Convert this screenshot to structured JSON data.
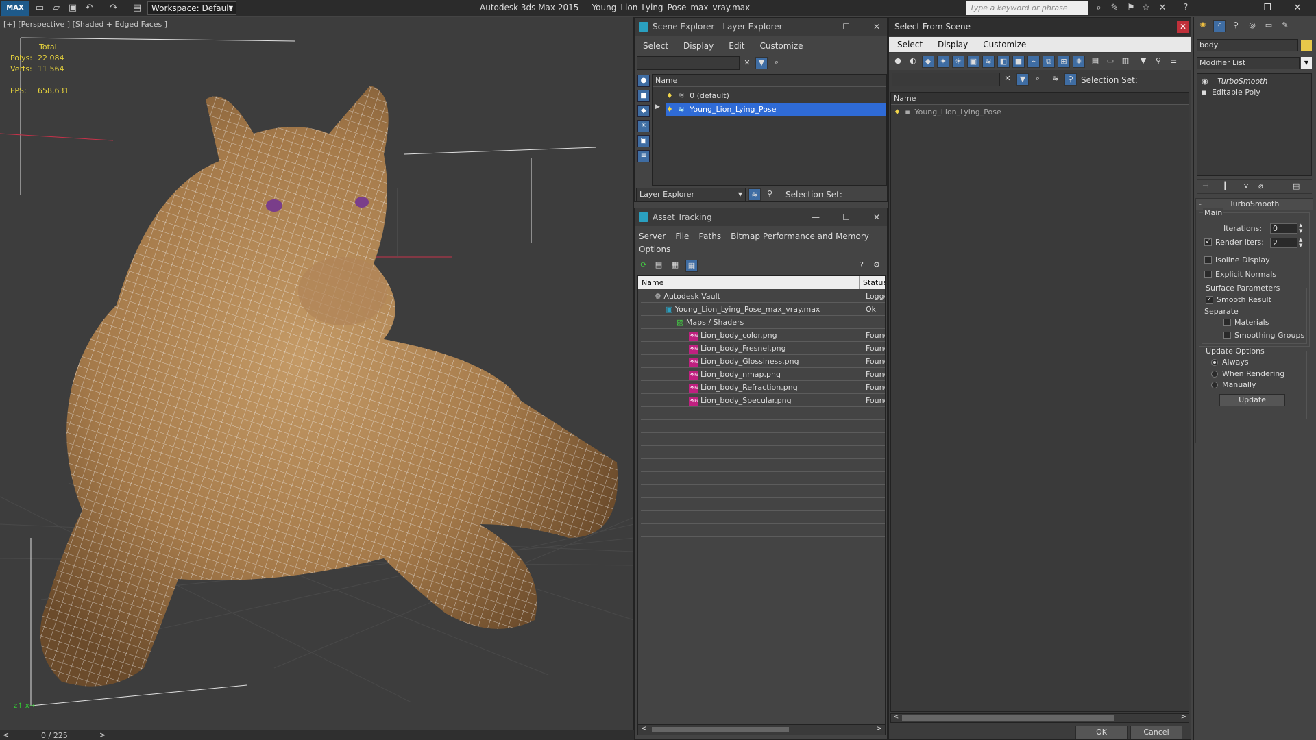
{
  "title_bar": {
    "logo": "MAX",
    "workspace": "Workspace: Default",
    "app_title": "Autodesk 3ds Max  2015",
    "file_title": "Young_Lion_Lying_Pose_max_vray.max",
    "search_placeholder": "Type a keyword or phrase"
  },
  "viewport": {
    "label": "[+] [Perspective ] [Shaded + Edged Faces ]",
    "stats": {
      "total_label": "Total",
      "polys_label": "Polys:",
      "polys_value": "22 084",
      "verts_label": "Verts:",
      "verts_value": "11 564",
      "fps_label": "FPS:",
      "fps_value": "658,631"
    },
    "timeline": "0 / 225"
  },
  "scene_explorer": {
    "title": "Scene Explorer - Layer Explorer",
    "menu": [
      "Select",
      "Display",
      "Edit",
      "Customize"
    ],
    "col_name": "Name",
    "items": [
      "0 (default)",
      "Young_Lion_Lying_Pose"
    ],
    "footer_dropdown": "Layer Explorer",
    "selection_set": "Selection Set:"
  },
  "asset_tracking": {
    "title": "Asset Tracking",
    "menu1": [
      "Server",
      "File",
      "Paths",
      "Bitmap Performance and Memory"
    ],
    "menu2": [
      "Options"
    ],
    "col_name": "Name",
    "col_status": "Status",
    "rows": [
      {
        "name": "Autodesk Vault",
        "status": "Logged"
      },
      {
        "name": "Young_Lion_Lying_Pose_max_vray.max",
        "status": "Ok"
      },
      {
        "name": "Maps / Shaders",
        "status": ""
      },
      {
        "name": "Lion_body_color.png",
        "status": "Found"
      },
      {
        "name": "Lion_body_Fresnel.png",
        "status": "Found"
      },
      {
        "name": "Lion_body_Glossiness.png",
        "status": "Found"
      },
      {
        "name": "Lion_body_nmap.png",
        "status": "Found"
      },
      {
        "name": "Lion_body_Refraction.png",
        "status": "Found"
      },
      {
        "name": "Lion_body_Specular.png",
        "status": "Found"
      }
    ],
    "png_badge": "PNG"
  },
  "select_from_scene": {
    "title": "Select From Scene",
    "menu": [
      "Select",
      "Display",
      "Customize"
    ],
    "selection_set": "Selection Set:",
    "col_name": "Name",
    "items": [
      "Young_Lion_Lying_Pose"
    ],
    "ok": "OK",
    "cancel": "Cancel"
  },
  "command_panel": {
    "object_name": "body",
    "modifier_list": "Modifier List",
    "stack": [
      "TurboSmooth",
      "Editable Poly"
    ],
    "rollout_title": "TurboSmooth",
    "main_group": "Main",
    "iterations_label": "Iterations:",
    "iterations_value": "0",
    "render_iters_label": "Render Iters:",
    "render_iters_value": "2",
    "isoline_display": "Isoline Display",
    "explicit_normals": "Explicit Normals",
    "surface_params": "Surface Parameters",
    "smooth_result": "Smooth Result",
    "separate": "Separate",
    "materials": "Materials",
    "smoothing_groups": "Smoothing Groups",
    "update_options": "Update Options",
    "always": "Always",
    "when_rendering": "When Rendering",
    "manually": "Manually",
    "update_button": "Update"
  }
}
